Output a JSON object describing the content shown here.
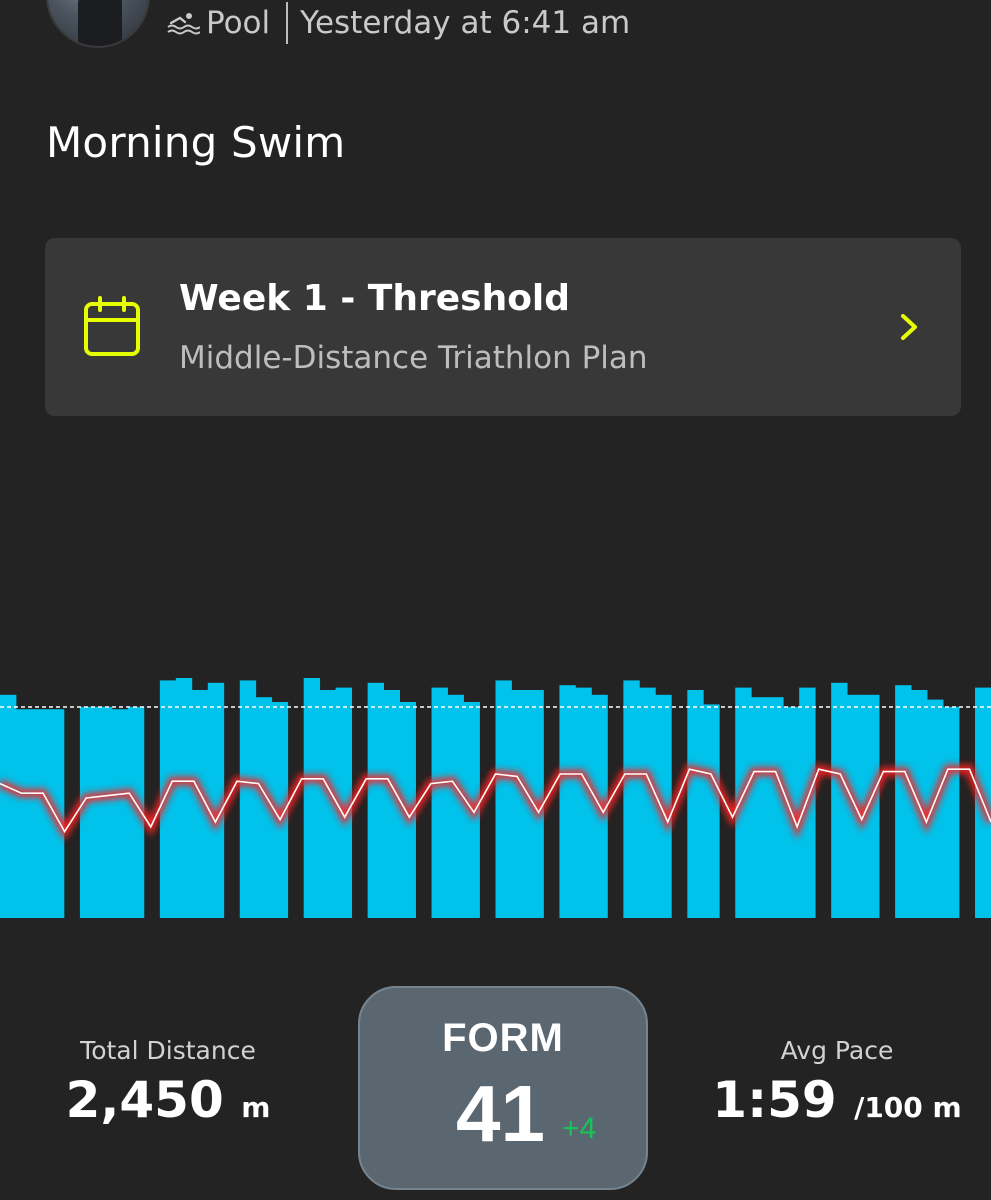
{
  "header": {
    "activity_type": "Pool",
    "timestamp": "Yesterday at 6:41 am",
    "title": "Morning Swim"
  },
  "plan": {
    "title": "Week 1 - Threshold",
    "subtitle": "Middle-Distance Triathlon Plan"
  },
  "colors": {
    "accent": "#e6ff00",
    "bars": "#00c2ea",
    "heart_rate_line": "#ff2020",
    "form_delta": "#19c35a",
    "background": "#232323",
    "card": "#383838"
  },
  "icons": {
    "activity": "swim-icon",
    "plan": "calendar-icon",
    "plan_action": "chevron-right-icon"
  },
  "chart_data": {
    "type": "bar",
    "baseline_dashed": true,
    "bar_heights": [
      0.93,
      0.87,
      0.87,
      0.87,
      0.0,
      0.88,
      0.88,
      0.87,
      0.88,
      0.0,
      0.99,
      1.0,
      0.95,
      0.98,
      0.0,
      0.99,
      0.92,
      0.9,
      0.0,
      1.0,
      0.95,
      0.96,
      0.0,
      0.98,
      0.95,
      0.9,
      0.0,
      0.96,
      0.93,
      0.9,
      0.0,
      0.99,
      0.95,
      0.95,
      0.0,
      0.97,
      0.96,
      0.93,
      0.0,
      0.99,
      0.96,
      0.93,
      0.0,
      0.95,
      0.89,
      0.0,
      0.96,
      0.92,
      0.92,
      0.88,
      0.96,
      0.0,
      0.98,
      0.93,
      0.93,
      0.0,
      0.97,
      0.95,
      0.91,
      0.88,
      0.0,
      0.96
    ],
    "heart_rate": [
      0.56,
      0.52,
      0.52,
      0.36,
      0.5,
      0.51,
      0.52,
      0.38,
      0.57,
      0.57,
      0.4,
      0.57,
      0.56,
      0.41,
      0.58,
      0.58,
      0.42,
      0.58,
      0.58,
      0.42,
      0.56,
      0.57,
      0.44,
      0.6,
      0.59,
      0.44,
      0.6,
      0.6,
      0.44,
      0.6,
      0.6,
      0.4,
      0.62,
      0.6,
      0.42,
      0.61,
      0.61,
      0.38,
      0.62,
      0.6,
      0.41,
      0.61,
      0.61,
      0.4,
      0.62,
      0.62,
      0.4
    ]
  },
  "stats": {
    "distance_label": "Total Distance",
    "distance_value": "2,450",
    "distance_unit": "m",
    "pace_label": "Avg Pace",
    "pace_value": "1:59",
    "pace_unit": "/100 m",
    "form_label": "FORM",
    "form_value": "41",
    "form_delta": "+4"
  }
}
